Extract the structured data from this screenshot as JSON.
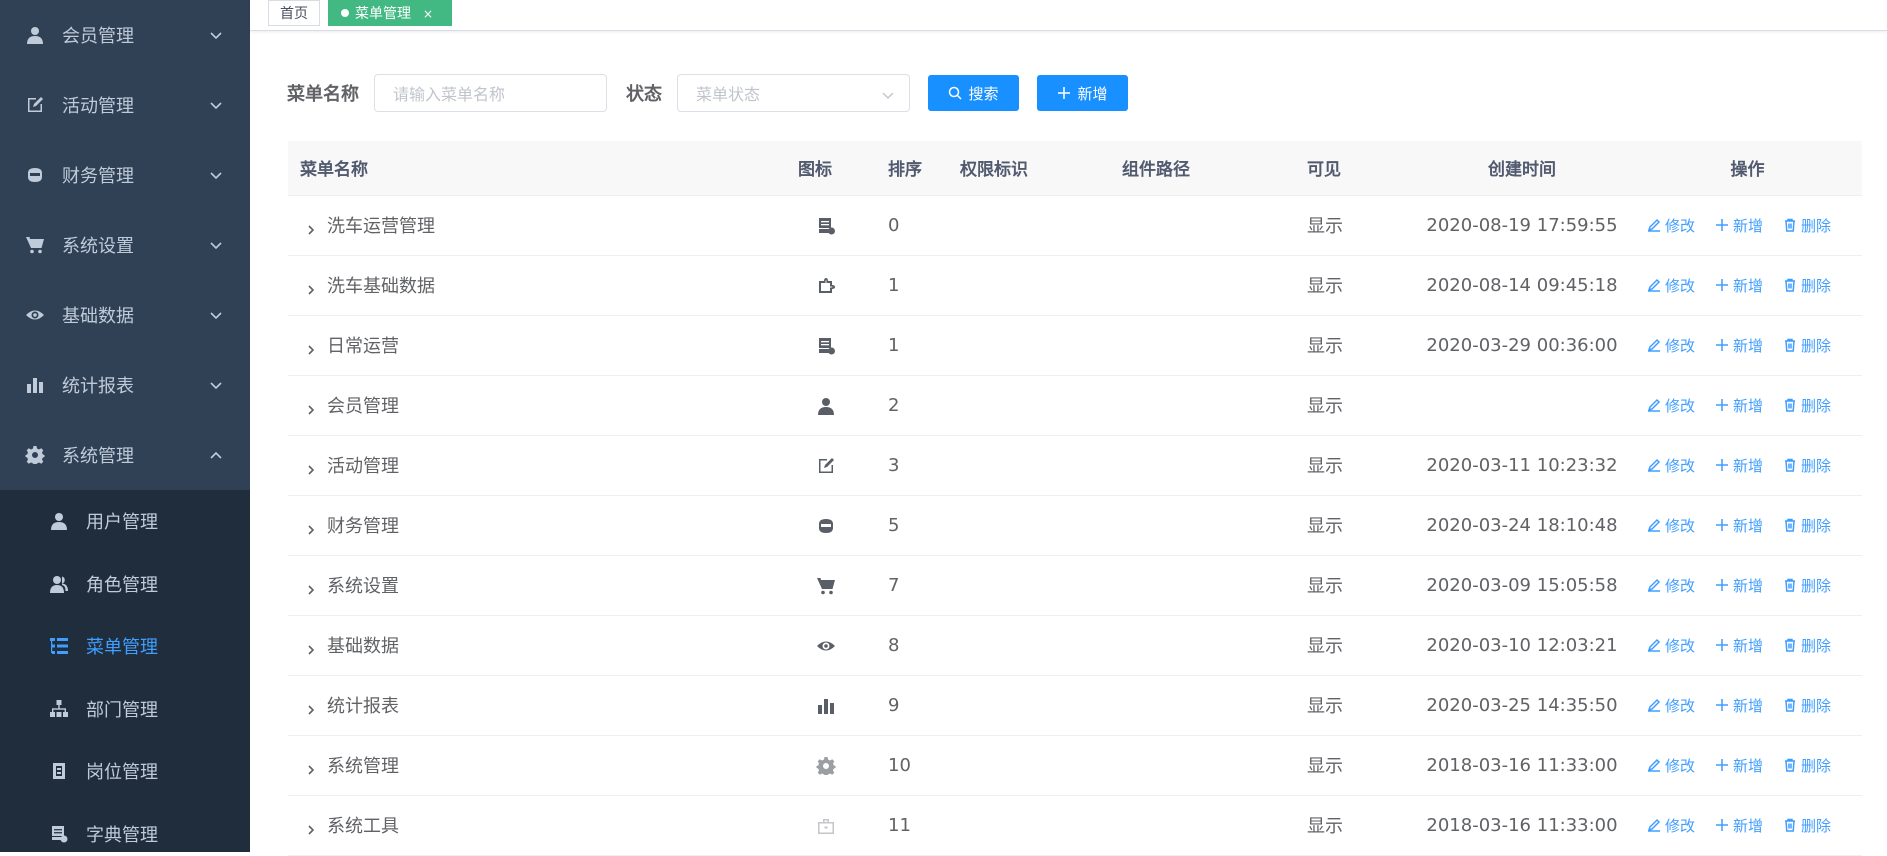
{
  "sidebar": {
    "menu": [
      {
        "label": "会员管理",
        "icon": "user-icon"
      },
      {
        "label": "活动管理",
        "icon": "edit-icon"
      },
      {
        "label": "财务管理",
        "icon": "money-icon"
      },
      {
        "label": "系统设置",
        "icon": "cart-icon"
      },
      {
        "label": "基础数据",
        "icon": "eye-icon"
      },
      {
        "label": "统计报表",
        "icon": "chart-icon"
      },
      {
        "label": "系统管理",
        "icon": "gear-icon"
      }
    ],
    "submenu": [
      {
        "label": "用户管理",
        "icon": "user-icon"
      },
      {
        "label": "角色管理",
        "icon": "peoples-icon"
      },
      {
        "label": "菜单管理",
        "icon": "tree-table-icon",
        "active": true
      },
      {
        "label": "部门管理",
        "icon": "tree-icon"
      },
      {
        "label": "岗位管理",
        "icon": "post-icon"
      },
      {
        "label": "字典管理",
        "icon": "dict-icon"
      }
    ]
  },
  "tags": {
    "home": "首页",
    "active": "菜单管理",
    "close": "×"
  },
  "search": {
    "name_label": "菜单名称",
    "name_placeholder": "请输入菜单名称",
    "status_label": "状态",
    "status_placeholder": "菜单状态",
    "search_btn": "搜索",
    "add_btn": "新增"
  },
  "table": {
    "headers": {
      "name": "菜单名称",
      "icon": "图标",
      "order": "排序",
      "perms": "权限标识",
      "component": "组件路径",
      "visible": "可见",
      "created": "创建时间",
      "ops": "操作"
    },
    "op_labels": {
      "edit": "修改",
      "add": "新增",
      "delete": "删除"
    },
    "rows": [
      {
        "name": "洗车运营管理",
        "icon": "server-icon",
        "order": "0",
        "visible": "显示",
        "created": "2020-08-19 17:59:55"
      },
      {
        "name": "洗车基础数据",
        "icon": "puzzle-icon",
        "order": "1",
        "visible": "显示",
        "created": "2020-08-14 09:45:18"
      },
      {
        "name": "日常运营",
        "icon": "server-icon",
        "order": "1",
        "visible": "显示",
        "created": "2020-03-29 00:36:00"
      },
      {
        "name": "会员管理",
        "icon": "user-icon",
        "order": "2",
        "visible": "显示",
        "created": ""
      },
      {
        "name": "活动管理",
        "icon": "edit-icon",
        "order": "3",
        "visible": "显示",
        "created": "2020-03-11 10:23:32"
      },
      {
        "name": "财务管理",
        "icon": "money-icon",
        "order": "5",
        "visible": "显示",
        "created": "2020-03-24 18:10:48"
      },
      {
        "name": "系统设置",
        "icon": "cart-icon",
        "order": "7",
        "visible": "显示",
        "created": "2020-03-09 15:05:58"
      },
      {
        "name": "基础数据",
        "icon": "eye-icon",
        "order": "8",
        "visible": "显示",
        "created": "2020-03-10 12:03:21"
      },
      {
        "name": "统计报表",
        "icon": "chart-icon",
        "order": "9",
        "visible": "显示",
        "created": "2020-03-25 14:35:50"
      },
      {
        "name": "系统管理",
        "icon": "gear-icon",
        "order": "10",
        "visible": "显示",
        "created": "2018-03-16 11:33:00"
      },
      {
        "name": "系统工具",
        "icon": "tool-icon",
        "order": "11",
        "visible": "显示",
        "created": "2018-03-16 11:33:00"
      }
    ]
  },
  "colors": {
    "sidebar_bg": "#304156",
    "submenu_bg": "#1f2d3d",
    "active_tag": "#42b983",
    "primary": "#1890ff",
    "link": "#409eff"
  }
}
